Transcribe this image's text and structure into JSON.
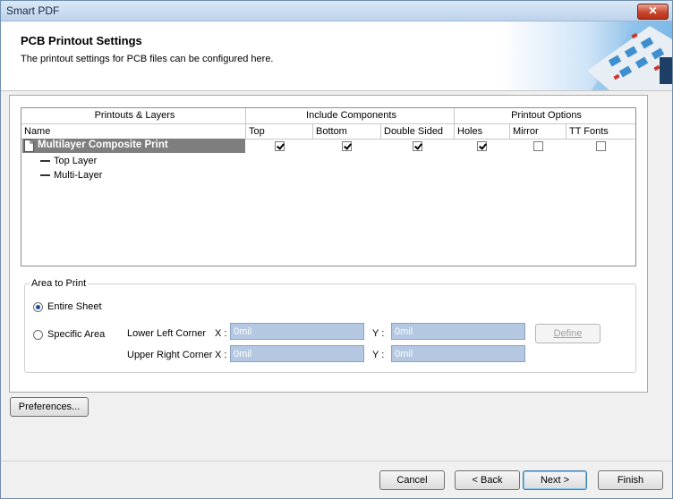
{
  "window": {
    "title": "Smart PDF",
    "close_glyph": "✕"
  },
  "header": {
    "title": "PCB Printout Settings",
    "subtitle": "The printout settings for PCB files can be configured here."
  },
  "grid": {
    "group_headers": [
      "Printouts & Layers",
      "Include Components",
      "Printout Options"
    ],
    "columns": [
      "Name",
      "Top",
      "Bottom",
      "Double Sided",
      "Holes",
      "Mirror",
      "TT Fonts"
    ],
    "rows": [
      {
        "name": "Multilayer Composite Print",
        "selected": true,
        "checks": {
          "top": true,
          "bottom": true,
          "double_sided": true,
          "holes": true,
          "mirror": false,
          "tt_fonts": false
        }
      }
    ],
    "layers": [
      "Top Layer",
      "Multi-Layer"
    ]
  },
  "area": {
    "legend": "Area to Print",
    "entire_sheet": "Entire Sheet",
    "specific_area": "Specific Area",
    "selected": "entire_sheet",
    "lower_left": "Lower Left Corner",
    "upper_right": "Upper Right Corner",
    "x_label": "X :",
    "y_label": "Y :",
    "ll_x": "0mil",
    "ll_y": "0mil",
    "ur_x": "0mil",
    "ur_y": "0mil",
    "define": "Define"
  },
  "buttons": {
    "preferences": "Preferences...",
    "cancel": "Cancel",
    "back": "< Back",
    "next": "Next >",
    "finish": "Finish"
  }
}
